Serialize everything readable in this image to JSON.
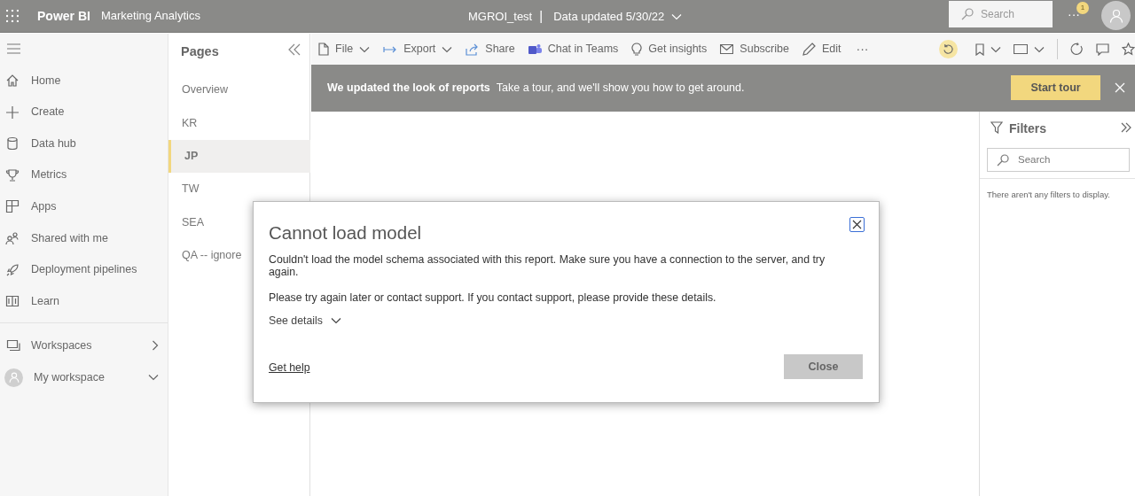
{
  "header": {
    "app": "Power BI",
    "workspace": "Marketing Analytics",
    "report": "MGROI_test",
    "separator": "|",
    "updated": "Data updated 5/30/22",
    "search_placeholder": "Search",
    "more": "···",
    "notification_count": "1"
  },
  "nav": {
    "items": [
      {
        "label": "Home"
      },
      {
        "label": "Create"
      },
      {
        "label": "Data hub"
      },
      {
        "label": "Metrics"
      },
      {
        "label": "Apps"
      },
      {
        "label": "Shared with me"
      },
      {
        "label": "Deployment pipelines"
      },
      {
        "label": "Learn"
      }
    ],
    "bottom": [
      {
        "label": "Workspaces"
      },
      {
        "label": "My workspace"
      }
    ]
  },
  "pages": {
    "title": "Pages",
    "items": [
      {
        "label": "Overview",
        "selected": false
      },
      {
        "label": "KR",
        "selected": false
      },
      {
        "label": "JP",
        "selected": true
      },
      {
        "label": "TW",
        "selected": false
      },
      {
        "label": "SEA",
        "selected": false
      },
      {
        "label": "QA -- ignore",
        "selected": false
      }
    ]
  },
  "toolbar": {
    "items": [
      {
        "label": "File",
        "dropdown": true
      },
      {
        "label": "Export",
        "dropdown": true
      },
      {
        "label": "Share",
        "dropdown": false
      },
      {
        "label": "Chat in Teams",
        "dropdown": false
      },
      {
        "label": "Get insights",
        "dropdown": false
      },
      {
        "label": "Subscribe",
        "dropdown": false
      },
      {
        "label": "Edit",
        "dropdown": false
      }
    ],
    "more": "···"
  },
  "banner": {
    "title": "We updated the look of reports",
    "text": "Take a tour, and we'll show you how to get around.",
    "button": "Start tour"
  },
  "filters": {
    "title": "Filters",
    "search_placeholder": "Search",
    "empty": "There aren't any filters to display."
  },
  "dialog": {
    "title": "Cannot load model",
    "message": "Couldn't load the model schema associated with this report. Make sure you have a connection to the server, and try again.",
    "support": "Please try again later or contact support. If you contact support, please provide these details.",
    "details": "See details",
    "help_link": "Get help",
    "button": "Close"
  }
}
